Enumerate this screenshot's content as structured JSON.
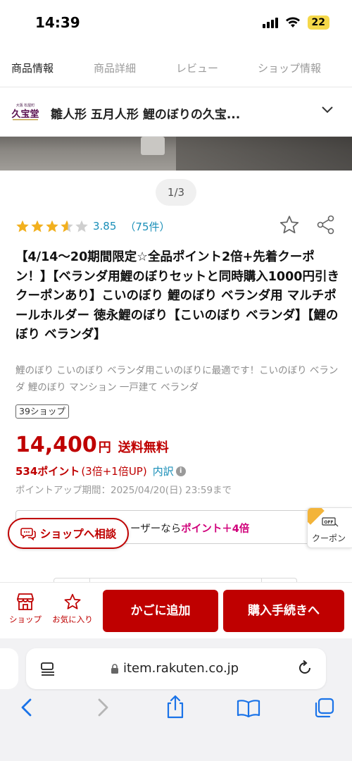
{
  "status_bar": {
    "time": "14:39",
    "battery": "22"
  },
  "tabs": [
    {
      "label": "商品情報",
      "active": true
    },
    {
      "label": "商品詳細",
      "active": false
    },
    {
      "label": "レビュー",
      "active": false
    },
    {
      "label": "ショップ情報",
      "active": false
    }
  ],
  "shop": {
    "name": "雛人形 五月人形 鯉のぼりの久宝...",
    "logo_text": "久宝堂",
    "logo_tagline": "大阪 松屋町"
  },
  "gallery": {
    "pager": "1/3"
  },
  "product": {
    "rating_value": "3.85",
    "rating_count": "（75件）",
    "rating_stars": 3.85,
    "title": "【4/14〜20期間限定☆全品ポイント2倍+先着クーポン！】【ベランダ用鯉のぼりセットと同時購入1000円引きクーポンあり】こいのぼり 鯉のぼり ベランダ用 マルチポールホルダー 徳永鯉のぼり【こいのぼり ベランダ】【鯉のぼり ベランダ】",
    "subtitle": "鯉のぼり こいのぼり ベランダ用こいのぼりに最適です！こいのぼり ベランダ 鯉のぼり マンション 一戸建て ベランダ",
    "badge": "39ショップ",
    "price": "14,400",
    "price_unit": "円",
    "shipping": "送料無料",
    "points": "534ポイント",
    "points_detail": "(3倍+1倍UP)",
    "points_breakdown": "内訳",
    "points_deadline": "ポイントアップ期間：2025/04/20(日) 23:59まで"
  },
  "promo": {
    "text": "ーザーなら",
    "highlight": "ポイント＋4倍"
  },
  "consult_button": "ショップへ相談",
  "coupon_tab": {
    "off_label": "OFF",
    "label": "クーポン"
  },
  "action_bar": {
    "shop_label": "ショップ",
    "favorite_label": "お気に入り",
    "cart_label": "かごに追加",
    "buy_label": "購入手続きへ"
  },
  "browser": {
    "url": "item.rakuten.co.jp"
  },
  "colors": {
    "brand_red": "#bf0000",
    "link_blue": "#1a8fb8",
    "star_gold": "#f2b01e",
    "promo_pink": "#d0007a"
  }
}
